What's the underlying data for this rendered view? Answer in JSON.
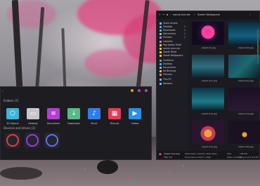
{
  "explorer": {
    "folders_title": "Folders (7)",
    "folders": [
      {
        "label": "3D Objects",
        "icon": "cube-icon",
        "color": "#3fb4d9"
      },
      {
        "label": "Desktop",
        "icon": "desktop-icon",
        "color": "#c8c6cc"
      },
      {
        "label": "Documents",
        "icon": "documents-icon",
        "color": "#b33dd6"
      },
      {
        "label": "Downloads",
        "icon": "download-icon",
        "color": "#58b98b"
      },
      {
        "label": "Music",
        "icon": "music-icon",
        "color": "#2f7ee8"
      },
      {
        "label": "Pictures",
        "icon": "pictures-icon",
        "color": "#e53b55"
      },
      {
        "label": "Videos",
        "icon": "videos-icon",
        "color": "#2a8fe6"
      }
    ],
    "devices_title": "Devices and drives (3)",
    "drives": [
      {
        "icon": "drive-icon",
        "color": "#e3384a"
      },
      {
        "icon": "drive-icon",
        "color": "#8b3ee8"
      },
      {
        "icon": "drive-icon",
        "color": "#5a6ff0"
      }
    ]
  },
  "gallery": {
    "breadcrumb": [
      "sandy-hoe.tar",
      "Sweet Wallpapers"
    ],
    "sidebar": [
      "Quick access",
      "Desktop",
      "Downloads",
      "Documents",
      "Pictures",
      "Libraries",
      "Pop Sweet Filled",
      "sandy-icons.tar",
      "Sweet Filled",
      "Sweet Wallpapers",
      "OneDrive",
      "Desktop",
      "Documents",
      "Ad Backups",
      "Pictures",
      "This PC",
      "Network"
    ],
    "thumbs": [
      "sweet (1).jpg",
      "sweet (10).jpg",
      "sweet (11).jpg",
      "sweet (12).jpg",
      "sweet (13).jpg",
      "sweet (14).jpg",
      "sweet (15).jpg",
      "sweet (16).jpg"
    ],
    "status": {
      "name": "sweet (13).png",
      "type": "PNG File",
      "date_label": "Date taken",
      "date_value": "Specify date taken",
      "size_label": "Size",
      "size_value": "148 KB",
      "dims_label": "Dimensions",
      "dims_value": "1920 x 1080",
      "modified_label": "Date modified",
      "modified_value": "26-Jul-19 3:43 PM"
    }
  },
  "colors": {
    "pink": "#e0588f",
    "panel": "#1d1c21"
  }
}
